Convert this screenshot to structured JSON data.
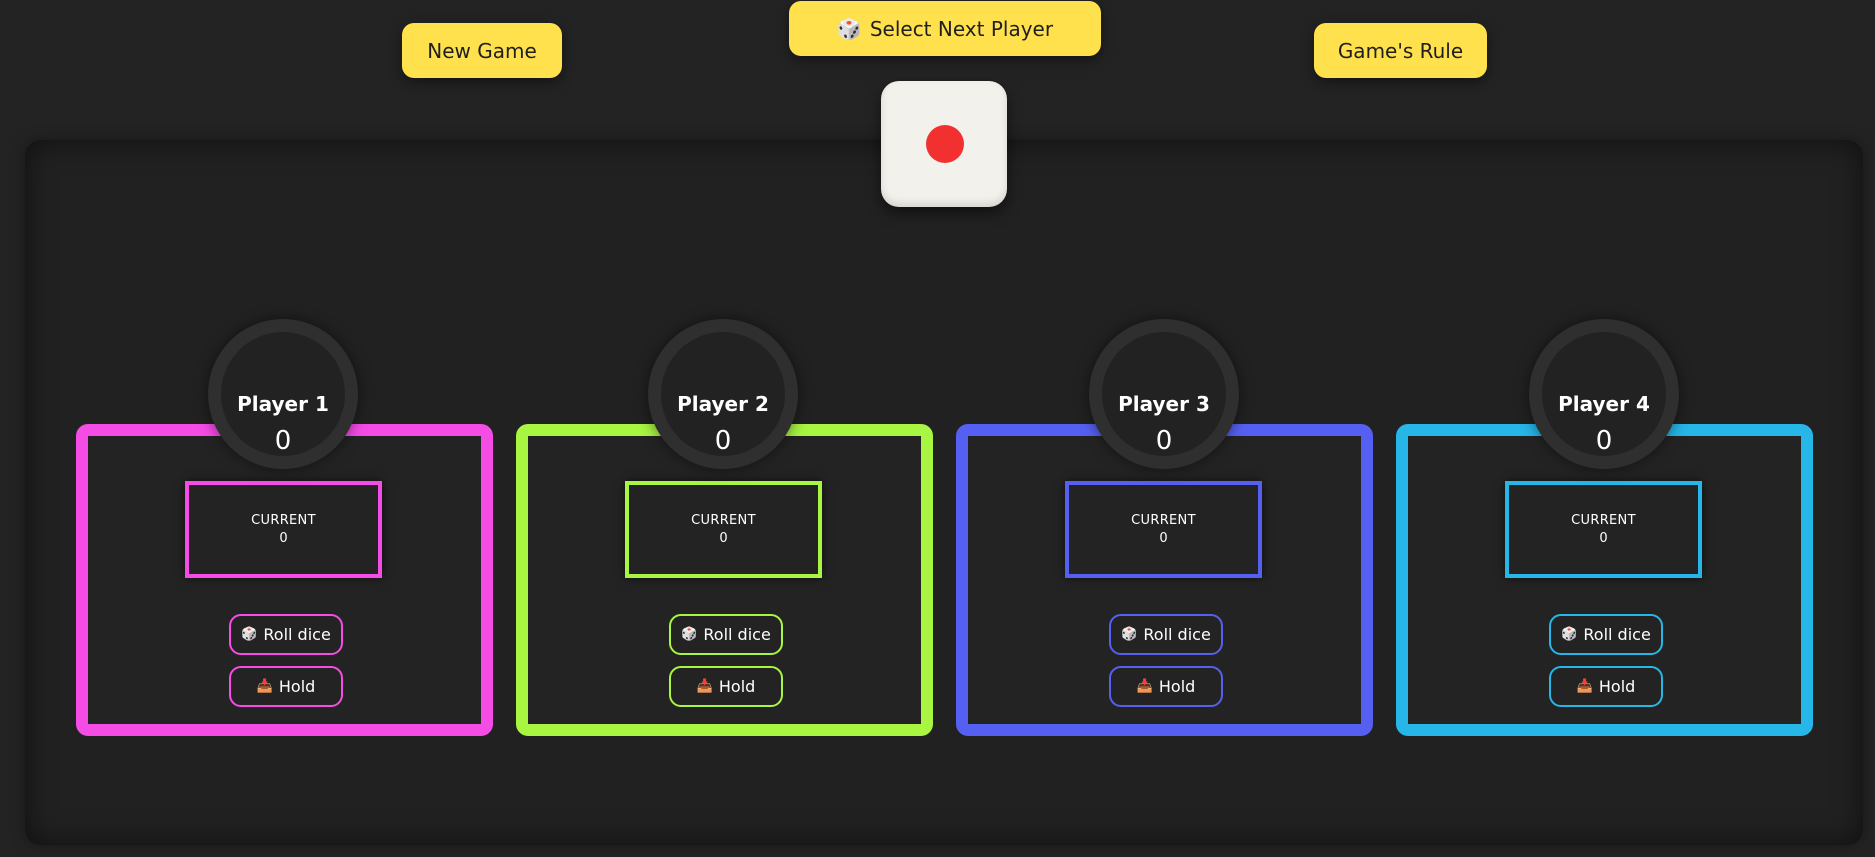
{
  "header": {
    "new_game": "New Game",
    "select_next": "Select Next Player",
    "games_rule": "Game's Rule"
  },
  "dice": {
    "value": 1,
    "pip_color": "#f2302f"
  },
  "players": [
    {
      "name": "Player 1",
      "score": "0",
      "current_label": "CURRENT",
      "current": "0",
      "roll_label": "Roll dice",
      "hold_label": "Hold",
      "color": "#f54ce6"
    },
    {
      "name": "Player 2",
      "score": "0",
      "current_label": "CURRENT",
      "current": "0",
      "roll_label": "Roll dice",
      "hold_label": "Hold",
      "color": "#a8f542"
    },
    {
      "name": "Player 3",
      "score": "0",
      "current_label": "CURRENT",
      "current": "0",
      "roll_label": "Roll dice",
      "hold_label": "Hold",
      "color": "#5560f2"
    },
    {
      "name": "Player 4",
      "score": "0",
      "current_label": "CURRENT",
      "current": "0",
      "roll_label": "Roll dice",
      "hold_label": "Hold",
      "color": "#26b6e8"
    }
  ],
  "colors": {
    "accent": "#ffe14d",
    "background": "#232323"
  }
}
